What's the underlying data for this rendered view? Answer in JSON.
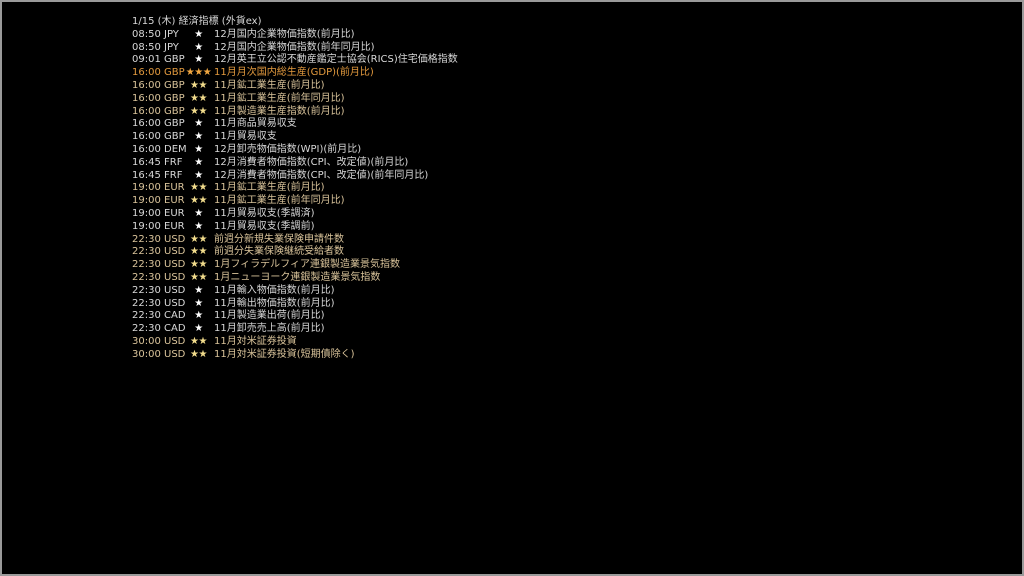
{
  "header": {
    "title": "1/15 (木) 経済指標 (外貨ex)"
  },
  "colors": {
    "importance_1": "#d8d8d8",
    "importance_2": "#d9c39a",
    "importance_3": "#e39a3e",
    "background": "#000000",
    "border": "#9a9a9a"
  },
  "events": [
    {
      "time": "08:50",
      "currency": "JPY",
      "stars": "★",
      "importance": 1,
      "title": "12月国内企業物価指数(前月比)"
    },
    {
      "time": "08:50",
      "currency": "JPY",
      "stars": "★",
      "importance": 1,
      "title": "12月国内企業物価指数(前年同月比)"
    },
    {
      "time": "09:01",
      "currency": "GBP",
      "stars": "★",
      "importance": 1,
      "title": "12月英王立公認不動産鑑定士協会(RICS)住宅価格指数"
    },
    {
      "time": "16:00",
      "currency": "GBP",
      "stars": "★★★",
      "importance": 3,
      "title": "11月月次国内総生産(GDP)(前月比)"
    },
    {
      "time": "16:00",
      "currency": "GBP",
      "stars": "★★",
      "importance": 2,
      "title": "11月鉱工業生産(前月比)"
    },
    {
      "time": "16:00",
      "currency": "GBP",
      "stars": "★★",
      "importance": 2,
      "title": "11月鉱工業生産(前年同月比)"
    },
    {
      "time": "16:00",
      "currency": "GBP",
      "stars": "★★",
      "importance": 2,
      "title": "11月製造業生産指数(前月比)"
    },
    {
      "time": "16:00",
      "currency": "GBP",
      "stars": "★",
      "importance": 1,
      "title": "11月商品貿易収支"
    },
    {
      "time": "16:00",
      "currency": "GBP",
      "stars": "★",
      "importance": 1,
      "title": "11月貿易収支"
    },
    {
      "time": "16:00",
      "currency": "DEM",
      "stars": "★",
      "importance": 1,
      "title": "12月卸売物価指数(WPI)(前月比)"
    },
    {
      "time": "16:45",
      "currency": "FRF",
      "stars": "★",
      "importance": 1,
      "title": "12月消費者物価指数(CPI、改定値)(前月比)"
    },
    {
      "time": "16:45",
      "currency": "FRF",
      "stars": "★",
      "importance": 1,
      "title": "12月消費者物価指数(CPI、改定値)(前年同月比)"
    },
    {
      "time": "19:00",
      "currency": "EUR",
      "stars": "★★",
      "importance": 2,
      "title": "11月鉱工業生産(前月比)"
    },
    {
      "time": "19:00",
      "currency": "EUR",
      "stars": "★★",
      "importance": 2,
      "title": "11月鉱工業生産(前年同月比)"
    },
    {
      "time": "19:00",
      "currency": "EUR",
      "stars": "★",
      "importance": 1,
      "title": "11月貿易収支(季調済)"
    },
    {
      "time": "19:00",
      "currency": "EUR",
      "stars": "★",
      "importance": 1,
      "title": "11月貿易収支(季調前)"
    },
    {
      "time": "22:30",
      "currency": "USD",
      "stars": "★★",
      "importance": 2,
      "title": "前週分新規失業保険申請件数"
    },
    {
      "time": "22:30",
      "currency": "USD",
      "stars": "★★",
      "importance": 2,
      "title": "前週分失業保険継続受給者数"
    },
    {
      "time": "22:30",
      "currency": "USD",
      "stars": "★★",
      "importance": 2,
      "title": "1月フィラデルフィア連銀製造業景気指数"
    },
    {
      "time": "22:30",
      "currency": "USD",
      "stars": "★★",
      "importance": 2,
      "title": "1月ニューヨーク連銀製造業景気指数"
    },
    {
      "time": "22:30",
      "currency": "USD",
      "stars": "★",
      "importance": 1,
      "title": "11月輸入物価指数(前月比)"
    },
    {
      "time": "22:30",
      "currency": "USD",
      "stars": "★",
      "importance": 1,
      "title": "11月輸出物価指数(前月比)"
    },
    {
      "time": "22:30",
      "currency": "CAD",
      "stars": "★",
      "importance": 1,
      "title": "11月製造業出荷(前月比)"
    },
    {
      "time": "22:30",
      "currency": "CAD",
      "stars": "★",
      "importance": 1,
      "title": "11月卸売売上高(前月比)"
    },
    {
      "time": "30:00",
      "currency": "USD",
      "stars": "★★",
      "importance": 2,
      "title": "11月対米証券投資"
    },
    {
      "time": "30:00",
      "currency": "USD",
      "stars": "★★",
      "importance": 2,
      "title": "11月対米証券投資(短期債除く)"
    }
  ]
}
